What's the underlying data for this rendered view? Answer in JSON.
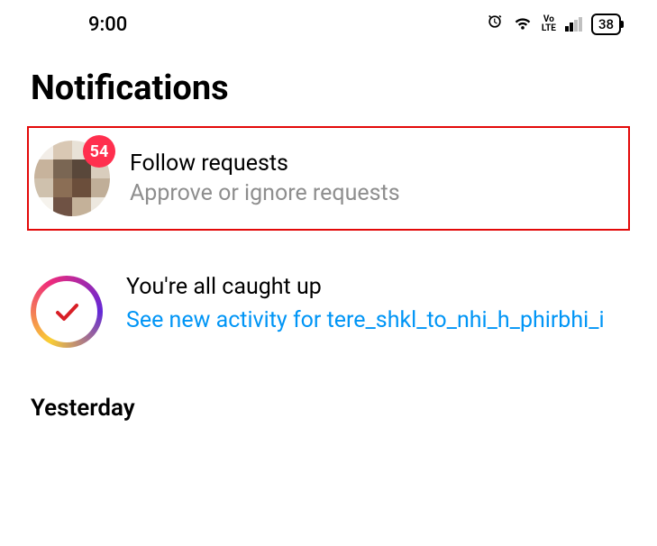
{
  "status_bar": {
    "time": "9:00",
    "volte_label": "Vo\nLTE",
    "battery_percent": "38"
  },
  "header": {
    "title": "Notifications"
  },
  "follow_requests": {
    "badge_count": "54",
    "title": "Follow requests",
    "subtitle": "Approve or ignore requests"
  },
  "caught_up": {
    "title": "You're all caught up",
    "link_prefix": "See new activity for ",
    "username": "tere_shkl_to_nhi_h_phirbhi_i"
  },
  "sections": {
    "yesterday": "Yesterday"
  }
}
